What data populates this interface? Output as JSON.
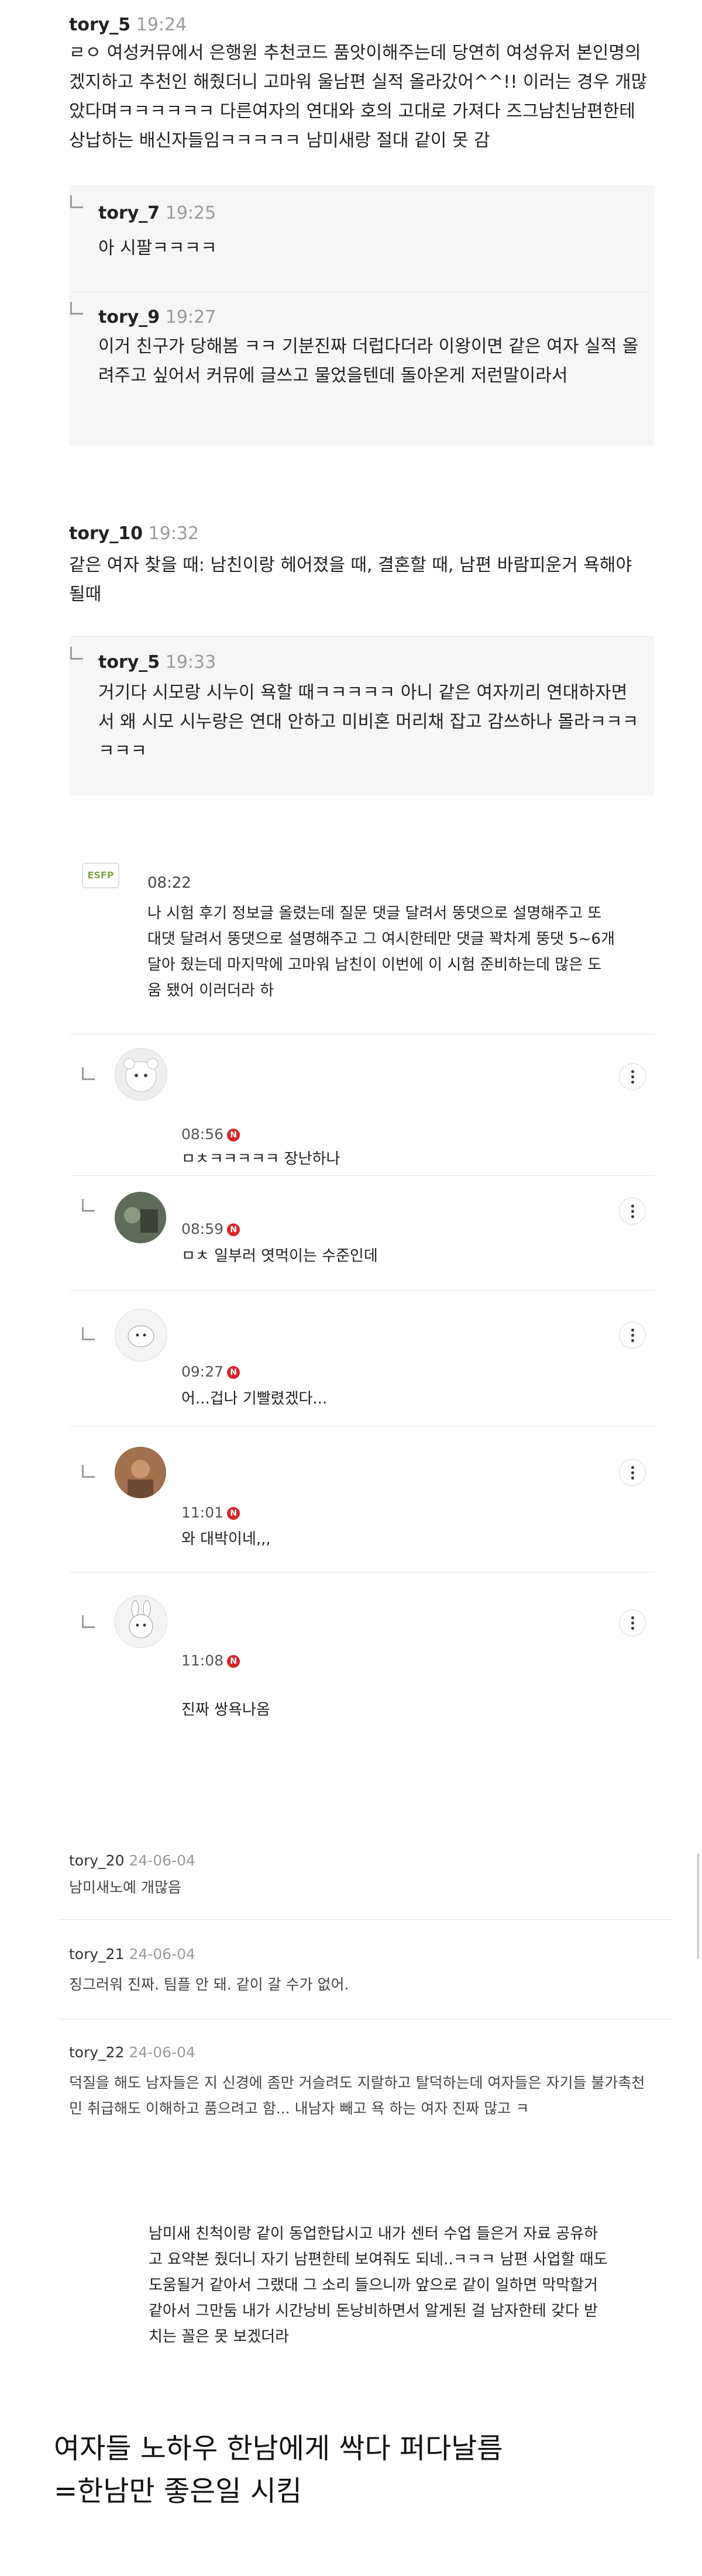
{
  "thread1": {
    "c1": {
      "user": "tory_5",
      "time": "19:24",
      "text": "ㄹㅇ 여성커뮤에서 은행원 추천코드 품앗이해주는데 당연히 여성유저 본인명의겠지하고 추천인 해줬더니 고마워 울남편 실적 올라갔어^^!! 이러는 경우 개많았다며ㅋㅋㅋㅋㅋㅋ 다른여자의 연대와 호의 고대로 가져다 즈그남친남편한테 상납하는 배신자들임ㅋㅋㅋㅋㅋ 남미새랑 절대 같이 못 감"
    },
    "r1": {
      "user": "tory_7",
      "time": "19:25",
      "text": "아 시팔ㅋㅋㅋㅋ"
    },
    "r2": {
      "user": "tory_9",
      "time": "19:27",
      "text": "이거 친구가 당해봄 ㅋㅋ 기분진짜 더럽다더라 이왕이면 같은 여자 실적 올려주고 싶어서 커뮤에 글쓰고 물었을텐데 돌아온게 저런말이라서"
    }
  },
  "thread2": {
    "c1": {
      "user": "tory_10",
      "time": "19:32",
      "text": "같은 여자 찾을 때: 남친이랑 헤어졌을 때, 결혼할 때,    남편 바람피운거 욕해야 될때"
    },
    "r1": {
      "user": "tory_5",
      "time": "19:33",
      "text": "거기다 시모랑 시누이 욕할 때ㅋㅋㅋㅋㅋ 아니 같은 여자끼리 연대하자면서 왜 시모 시누랑은 연대 안하고 미비혼 머리채 잡고 감쓰하나 몰라ㅋㅋㅋㅋㅋㅋ"
    }
  },
  "thread3": {
    "main": {
      "avatar_text": "ESFP",
      "time": "08:22",
      "text": "나 시험 후기 정보글 올렸는데 질문 댓글 달려서 뚱댓으로 설명해주고 또 대댓 달려서 뚱댓으로 설명해주고 그 여시한테만 댓글 꽉차게 뚱댓 5~6개 달아 줬는데 마지막에 고마워 남친이 이번에 이 시험 준비하는데 많은 도움 됐어 이러더라 하"
    },
    "replies": [
      {
        "time": "08:56",
        "badge": "N",
        "text": "ㅁㅊㅋㅋㅋㅋㅋ 장난하나"
      },
      {
        "time": "08:59",
        "badge": "N",
        "text": "ㅁㅊ 일부러 엿먹이는 수준인데"
      },
      {
        "time": "09:27",
        "badge": "N",
        "text": "어...겁나 기빨렸겠다..."
      },
      {
        "time": "11:01",
        "badge": "N",
        "text": "와 대박이네,,,"
      },
      {
        "time": "11:08",
        "badge": "N",
        "text": "진짜 쌍욕나옴"
      }
    ]
  },
  "thread4": [
    {
      "user": "tory_20",
      "date": "24-06-04",
      "text": "남미새노예 개많음"
    },
    {
      "user": "tory_21",
      "date": "24-06-04",
      "text": "징그러워 진짜. 팀플 안 돼. 같이 갈 수가 없어."
    },
    {
      "user": "tory_22",
      "date": "24-06-04",
      "text": "덕질을 해도 남자들은 지 신경에 좀만 거슬려도 지랄하고 탈덕하는데 여자들은 자기들 불가촉천민 취급해도 이해하고 품으려고 함... 내남자 빼고 욕 하는 여자 진짜 많고 ㅋ"
    }
  ],
  "block5": {
    "text": "남미새 친척이랑 같이 동업한답시고 내가 센터 수업 들은거 자료 공유하고 요약본 줬더니 자기 남편한테 보여줘도 되네..ㅋㅋㅋ 남편 사업할 때도 도움될거 같아서 그랬대 그 소리 들으니까 앞으로 같이 일하면 막막할거 같아서 그만둠 내가 시간낭비 돈낭비하면서 알게된 걸 남자한테 갖다 받치는 꼴은 못 보겠더라"
  },
  "conclusion": {
    "line1": "여자들 노하우 한남에게 싹다 퍼다날름",
    "line2": "=한남만 좋은일 시킴"
  },
  "icons": {
    "reply": "reply-arrow-icon",
    "menu": "more-vert-icon",
    "badge": "new-badge"
  },
  "colors": {
    "badge": "#d6262a",
    "muted": "#9a9a9a",
    "reply_bg": "#f6f6f6"
  }
}
